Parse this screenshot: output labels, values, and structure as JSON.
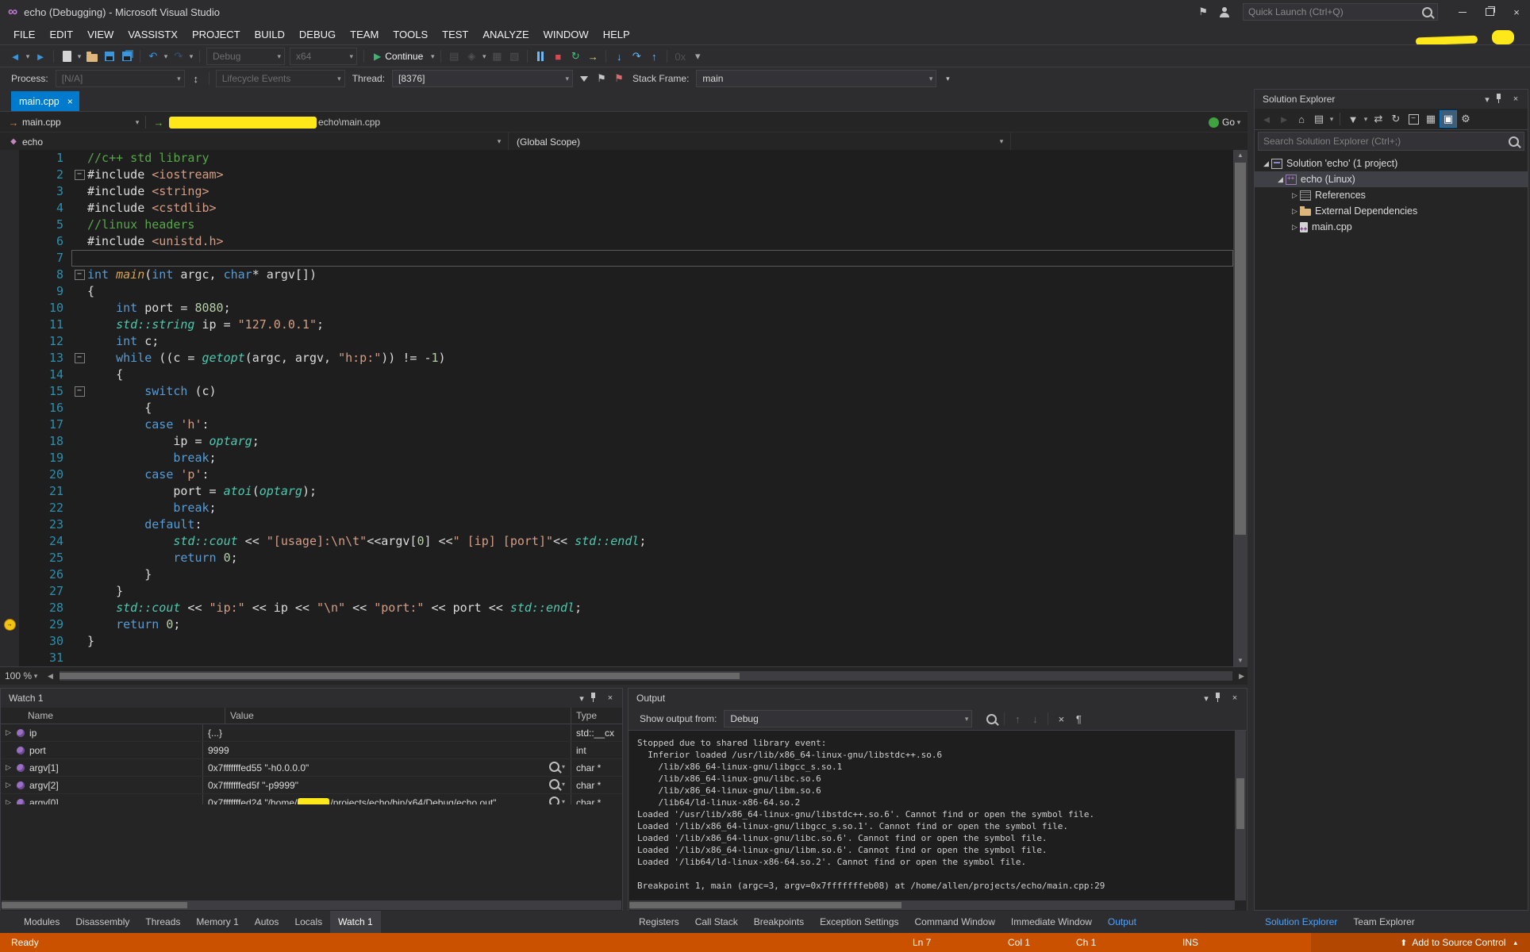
{
  "title_bar": {
    "title": "echo (Debugging) - Microsoft Visual Studio",
    "quick_launch_placeholder": "Quick Launch (Ctrl+Q)"
  },
  "menu": {
    "items": [
      "FILE",
      "EDIT",
      "VIEW",
      "VASSISTX",
      "PROJECT",
      "BUILD",
      "DEBUG",
      "TEAM",
      "TOOLS",
      "TEST",
      "ANALYZE",
      "WINDOW",
      "HELP"
    ]
  },
  "toolbar": {
    "group1": [
      {
        "icon": "nav-back-icon",
        "dropdown": true
      },
      {
        "icon": "nav-forward-icon"
      },
      {
        "sep": true
      },
      {
        "icon": "new-file-icon",
        "dropdown": true
      },
      {
        "icon": "open-file-icon"
      },
      {
        "icon": "save-icon"
      },
      {
        "icon": "save-all-icon"
      },
      {
        "sep": true
      },
      {
        "icon": "undo-icon",
        "dropdown": true
      },
      {
        "icon": "redo-icon",
        "dropdown": true,
        "disabled": true
      },
      {
        "sep": true
      }
    ],
    "solution_config": "Debug",
    "platform": "x64",
    "continue_label": "Continue",
    "group2": [
      {
        "sep": true
      },
      {
        "icon": "misc-tool-icon-1",
        "disabled": true
      },
      {
        "icon": "misc-tool-icon-2",
        "disabled": true,
        "dropdown": true
      },
      {
        "icon": "misc-tool-icon-3",
        "disabled": true
      },
      {
        "icon": "misc-tool-icon-4",
        "disabled": true
      },
      {
        "sep": true
      },
      {
        "icon": "break-all-icon"
      },
      {
        "icon": "stop-debugging-icon"
      },
      {
        "icon": "restart-icon"
      },
      {
        "icon": "show-next-statement-icon"
      },
      {
        "sep": true
      },
      {
        "icon": "step-into-icon"
      },
      {
        "icon": "step-over-icon"
      },
      {
        "icon": "step-out-icon"
      },
      {
        "sep": true
      },
      {
        "icon": "hex-display-icon",
        "disabled": true
      },
      {
        "icon": "toolbar-overflow-icon"
      }
    ]
  },
  "debug_location": {
    "process_label": "Process:",
    "process_value": "[N/A]",
    "lifecycle_label": "Lifecycle Events",
    "thread_label": "Thread:",
    "thread_value": "[8376]",
    "stack_frame_label": "Stack Frame:",
    "stack_frame_value": "main",
    "icons_mid": [
      {
        "icon": "thread-spinner-icon"
      },
      {
        "sep": true
      }
    ],
    "icons_after_thread": [
      {
        "icon": "thread-filter-icon"
      },
      {
        "icon": "flag-current-thread-icon"
      },
      {
        "icon": "flag-marked-threads-icon"
      }
    ],
    "overflow_icon": "debug-location-overflow-icon"
  },
  "editor": {
    "tab_title": "main.cpp",
    "nav": {
      "file_combo": "main.cpp",
      "path_visible": "echo\\main.cpp",
      "go_label": "Go"
    },
    "scope": {
      "left": "echo",
      "right": "(Global Scope)"
    },
    "zoom": "100 %",
    "caret_line": 7,
    "breakpoint_line": 29,
    "code_lines": [
      {
        "n": 1,
        "fold": "",
        "tokens": [
          [
            "cm",
            "//c++ std library"
          ]
        ]
      },
      {
        "n": 2,
        "fold": "-",
        "tokens": [
          [
            "pl",
            "#include "
          ],
          [
            "str",
            "<iostream>"
          ]
        ]
      },
      {
        "n": 3,
        "fold": "",
        "tokens": [
          [
            "pl",
            "#include "
          ],
          [
            "str",
            "<string>"
          ]
        ]
      },
      {
        "n": 4,
        "fold": "",
        "tokens": [
          [
            "pl",
            "#include "
          ],
          [
            "str",
            "<cstdlib>"
          ]
        ]
      },
      {
        "n": 5,
        "fold": "",
        "tokens": [
          [
            "cm",
            "//linux headers"
          ]
        ]
      },
      {
        "n": 6,
        "fold": "",
        "tokens": [
          [
            "pl",
            "#include "
          ],
          [
            "str",
            "<unistd.h>"
          ]
        ]
      },
      {
        "n": 7,
        "fold": "",
        "tokens": []
      },
      {
        "n": 8,
        "fold": "-",
        "tokens": [
          [
            "kw",
            "int"
          ],
          [
            "pl",
            " "
          ],
          [
            "fn",
            "main"
          ],
          [
            "pl",
            "("
          ],
          [
            "kw",
            "int"
          ],
          [
            "pl",
            " argc, "
          ],
          [
            "kw",
            "char"
          ],
          [
            "pl",
            "* argv[])"
          ]
        ]
      },
      {
        "n": 9,
        "fold": "",
        "tokens": [
          [
            "pl",
            "{"
          ]
        ]
      },
      {
        "n": 10,
        "fold": "",
        "tokens": [
          [
            "pl",
            "    "
          ],
          [
            "kw",
            "int"
          ],
          [
            "pl",
            " port = "
          ],
          [
            "num",
            "8080"
          ],
          [
            "pl",
            ";"
          ]
        ]
      },
      {
        "n": 11,
        "fold": "",
        "tokens": [
          [
            "pl",
            "    "
          ],
          [
            "typ",
            "std::string"
          ],
          [
            "pl",
            " ip = "
          ],
          [
            "str",
            "\"127.0.0.1\""
          ],
          [
            "pl",
            ";"
          ]
        ]
      },
      {
        "n": 12,
        "fold": "",
        "tokens": [
          [
            "pl",
            "    "
          ],
          [
            "kw",
            "int"
          ],
          [
            "pl",
            " c;"
          ]
        ]
      },
      {
        "n": 13,
        "fold": "-",
        "tokens": [
          [
            "pl",
            "    "
          ],
          [
            "kw",
            "while"
          ],
          [
            "pl",
            " ((c = "
          ],
          [
            "typ",
            "getopt"
          ],
          [
            "pl",
            "(argc, argv, "
          ],
          [
            "str",
            "\"h:p:\""
          ],
          [
            "pl",
            ")) != -"
          ],
          [
            "num",
            "1"
          ],
          [
            "pl",
            ")"
          ]
        ]
      },
      {
        "n": 14,
        "fold": "",
        "tokens": [
          [
            "pl",
            "    {"
          ]
        ]
      },
      {
        "n": 15,
        "fold": "-",
        "tokens": [
          [
            "pl",
            "        "
          ],
          [
            "kw",
            "switch"
          ],
          [
            "pl",
            " (c)"
          ]
        ]
      },
      {
        "n": 16,
        "fold": "",
        "tokens": [
          [
            "pl",
            "        {"
          ]
        ]
      },
      {
        "n": 17,
        "fold": "",
        "tokens": [
          [
            "pl",
            "        "
          ],
          [
            "kw",
            "case"
          ],
          [
            "pl",
            " "
          ],
          [
            "str",
            "'h'"
          ],
          [
            "pl",
            ":"
          ]
        ]
      },
      {
        "n": 18,
        "fold": "",
        "tokens": [
          [
            "pl",
            "            ip = "
          ],
          [
            "typ",
            "optarg"
          ],
          [
            "pl",
            ";"
          ]
        ]
      },
      {
        "n": 19,
        "fold": "",
        "tokens": [
          [
            "pl",
            "            "
          ],
          [
            "kw",
            "break"
          ],
          [
            "pl",
            ";"
          ]
        ]
      },
      {
        "n": 20,
        "fold": "",
        "tokens": [
          [
            "pl",
            "        "
          ],
          [
            "kw",
            "case"
          ],
          [
            "pl",
            " "
          ],
          [
            "str",
            "'p'"
          ],
          [
            "pl",
            ":"
          ]
        ]
      },
      {
        "n": 21,
        "fold": "",
        "tokens": [
          [
            "pl",
            "            port = "
          ],
          [
            "typ",
            "atoi"
          ],
          [
            "pl",
            "("
          ],
          [
            "typ",
            "optarg"
          ],
          [
            "pl",
            ");"
          ]
        ]
      },
      {
        "n": 22,
        "fold": "",
        "tokens": [
          [
            "pl",
            "            "
          ],
          [
            "kw",
            "break"
          ],
          [
            "pl",
            ";"
          ]
        ]
      },
      {
        "n": 23,
        "fold": "",
        "tokens": [
          [
            "pl",
            "        "
          ],
          [
            "kw",
            "default"
          ],
          [
            "pl",
            ":"
          ]
        ]
      },
      {
        "n": 24,
        "fold": "",
        "tokens": [
          [
            "pl",
            "            "
          ],
          [
            "typ",
            "std::cout"
          ],
          [
            "pl",
            " << "
          ],
          [
            "str",
            "\"[usage]:\\n\\t\""
          ],
          [
            "pl",
            "<<argv["
          ],
          [
            "num",
            "0"
          ],
          [
            "pl",
            "] <<"
          ],
          [
            "str",
            "\" [ip] [port]\""
          ],
          [
            "pl",
            "<< "
          ],
          [
            "typ",
            "std::endl"
          ],
          [
            "pl",
            ";"
          ]
        ]
      },
      {
        "n": 25,
        "fold": "",
        "tokens": [
          [
            "pl",
            "            "
          ],
          [
            "kw",
            "return"
          ],
          [
            "pl",
            " "
          ],
          [
            "num",
            "0"
          ],
          [
            "pl",
            ";"
          ]
        ]
      },
      {
        "n": 26,
        "fold": "",
        "tokens": [
          [
            "pl",
            "        }"
          ]
        ]
      },
      {
        "n": 27,
        "fold": "",
        "tokens": [
          [
            "pl",
            "    }"
          ]
        ]
      },
      {
        "n": 28,
        "fold": "",
        "tokens": [
          [
            "pl",
            "    "
          ],
          [
            "typ",
            "std::cout"
          ],
          [
            "pl",
            " << "
          ],
          [
            "str",
            "\"ip:\""
          ],
          [
            "pl",
            " << ip << "
          ],
          [
            "str",
            "\"\\n\""
          ],
          [
            "pl",
            " << "
          ],
          [
            "str",
            "\"port:\""
          ],
          [
            "pl",
            " << port << "
          ],
          [
            "typ",
            "std::endl"
          ],
          [
            "pl",
            ";"
          ]
        ]
      },
      {
        "n": 29,
        "fold": "",
        "tokens": [
          [
            "pl",
            "    "
          ],
          [
            "kw",
            "return"
          ],
          [
            "pl",
            " "
          ],
          [
            "num",
            "0"
          ],
          [
            "pl",
            ";"
          ]
        ]
      },
      {
        "n": 30,
        "fold": "",
        "tokens": [
          [
            "pl",
            "}"
          ]
        ]
      },
      {
        "n": 31,
        "fold": "",
        "tokens": []
      }
    ]
  },
  "watch": {
    "title": "Watch 1",
    "columns": [
      "Name",
      "Value",
      "Type"
    ],
    "rows": [
      {
        "name": "ip",
        "expandable": true,
        "value": "{...}",
        "type": "std::__cx",
        "magnifier": false
      },
      {
        "name": "port",
        "expandable": false,
        "value": "9999",
        "type": "int",
        "magnifier": false
      },
      {
        "name": "argv[1]",
        "expandable": true,
        "value": "0x7fffffffed55 \"-h0.0.0.0\"",
        "type": "char *",
        "magnifier": true
      },
      {
        "name": "argv[2]",
        "expandable": true,
        "value": "0x7fffffffed5f \"-p9999\"",
        "type": "char *",
        "magnifier": true
      },
      {
        "name": "argv[0]",
        "expandable": true,
        "value_prefix": "0x7fffffffed24 \"/home/",
        "value_redacted": true,
        "value_suffix": "/projects/echo/bin/x64/Debug/echo.out\"",
        "type": "char *",
        "magnifier": true
      }
    ]
  },
  "output": {
    "title": "Output",
    "show_output_from_label": "Show output from:",
    "source": "Debug",
    "toolbar_icons": [
      {
        "icon": "find-message-icon"
      },
      {
        "sep": true
      },
      {
        "icon": "previous-message-icon",
        "disabled": true
      },
      {
        "icon": "next-message-icon",
        "disabled": true
      },
      {
        "sep": true
      },
      {
        "icon": "clear-all-icon"
      },
      {
        "icon": "word-wrap-icon"
      }
    ],
    "lines": [
      "Stopped due to shared library event:",
      "  Inferior loaded /usr/lib/x86_64-linux-gnu/libstdc++.so.6",
      "    /lib/x86_64-linux-gnu/libgcc_s.so.1",
      "    /lib/x86_64-linux-gnu/libc.so.6",
      "    /lib/x86_64-linux-gnu/libm.so.6",
      "    /lib64/ld-linux-x86-64.so.2",
      "Loaded '/usr/lib/x86_64-linux-gnu/libstdc++.so.6'. Cannot find or open the symbol file.",
      "Loaded '/lib/x86_64-linux-gnu/libgcc_s.so.1'. Cannot find or open the symbol file.",
      "Loaded '/lib/x86_64-linux-gnu/libc.so.6'. Cannot find or open the symbol file.",
      "Loaded '/lib/x86_64-linux-gnu/libm.so.6'. Cannot find or open the symbol file.",
      "Loaded '/lib64/ld-linux-x86-64.so.2'. Cannot find or open the symbol file.",
      "",
      "Breakpoint 1, main (argc=3, argv=0x7fffffffeb08) at /home/allen/projects/echo/main.cpp:29"
    ]
  },
  "solution_explorer": {
    "title": "Solution Explorer",
    "search_placeholder": "Search Solution Explorer (Ctrl+;)",
    "toolbar_icons": [
      {
        "icon": "se-back-icon",
        "disabled": true
      },
      {
        "icon": "se-forward-icon",
        "disabled": true
      },
      {
        "icon": "home-icon"
      },
      {
        "icon": "switch-views-icon",
        "dropdown": true
      },
      {
        "sep": true
      },
      {
        "icon": "pending-changes-filter-icon",
        "dropdown": true
      },
      {
        "icon": "sync-with-active-document-icon"
      },
      {
        "icon": "refresh-icon"
      },
      {
        "icon": "collapse-all-icon"
      },
      {
        "icon": "show-all-files-icon"
      },
      {
        "icon": "preview-selected-items-icon",
        "active": true
      },
      {
        "icon": "properties-icon"
      }
    ],
    "tree": [
      {
        "label": "Solution 'echo' (1 project)",
        "indent": 0,
        "icon": "solution",
        "arrow": "expanded",
        "selected": false
      },
      {
        "label": "echo (Linux)",
        "indent": 1,
        "icon": "project",
        "arrow": "expanded",
        "selected": true
      },
      {
        "label": "References",
        "indent": 2,
        "icon": "references",
        "arrow": "collapsed",
        "selected": false
      },
      {
        "label": "External Dependencies",
        "indent": 2,
        "icon": "folder",
        "arrow": "collapsed",
        "selected": false
      },
      {
        "label": "main.cpp",
        "indent": 2,
        "icon": "cpp",
        "arrow": "collapsed",
        "selected": false
      }
    ],
    "bottom_tabs": [
      {
        "label": "Solution Explorer",
        "active": true
      },
      {
        "label": "Team Explorer",
        "active": false
      }
    ]
  },
  "bottom_tabs": {
    "left": [
      {
        "label": "Modules",
        "active": false
      },
      {
        "label": "Disassembly",
        "active": false
      },
      {
        "label": "Threads",
        "active": false
      },
      {
        "label": "Memory 1",
        "active": false
      },
      {
        "label": "Autos",
        "active": false
      },
      {
        "label": "Locals",
        "active": false
      },
      {
        "label": "Watch 1",
        "active": true
      }
    ],
    "right": [
      {
        "label": "Registers",
        "active": false
      },
      {
        "label": "Call Stack",
        "active": false
      },
      {
        "label": "Breakpoints",
        "active": false
      },
      {
        "label": "Exception Settings",
        "active": false
      },
      {
        "label": "Command Window",
        "active": false
      },
      {
        "label": "Immediate Window",
        "active": false
      },
      {
        "label": "Output",
        "active": true
      }
    ]
  },
  "status_bar": {
    "message": "Ready",
    "line": "Ln 7",
    "column": "Col 1",
    "character": "Ch 1",
    "mode": "INS",
    "source_control": "Add to Source Control"
  },
  "colors": {
    "accent": "#007ACC",
    "status_debug": "#CA5100",
    "redaction": "#FFE81A"
  }
}
